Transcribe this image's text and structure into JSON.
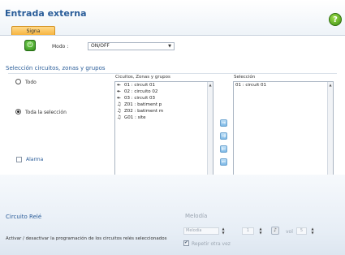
{
  "header": {
    "title": "Entrada externa",
    "help_glyph": "?",
    "tabs": [
      {
        "label": "Signa"
      }
    ]
  },
  "mode": {
    "label": "Modo :",
    "value": "ON/OFF",
    "power_icon": "power-icon"
  },
  "selection_section": {
    "title": "Selección circuitos, zonas y grupos",
    "radio_options": [
      {
        "label": "Todo",
        "selected": false
      },
      {
        "label": "Toda la selección",
        "selected": true
      }
    ],
    "alarm_label": "Alarma",
    "available_caption": "Cicuitos, Zonas y grupos",
    "available_items": [
      {
        "glyph": "↞",
        "text": "01 : circuit  01"
      },
      {
        "glyph": "↞",
        "text": "02 : circuito  02"
      },
      {
        "glyph": "↞",
        "text": "03 : circuit  03"
      },
      {
        "glyph": "♫",
        "text": "Z01 : batiment p"
      },
      {
        "glyph": "♫",
        "text": "Z02 : batiment m"
      },
      {
        "glyph": "♫",
        "text": "G01 : site"
      }
    ],
    "selected_caption": "Selección",
    "selected_items": [
      {
        "text": "01 : circuit  01"
      }
    ],
    "transfer_buttons": [
      "⇒",
      "⇉",
      "⇇",
      "⇐"
    ]
  },
  "relay_section": {
    "title": "Circuito Relé",
    "description": "Activar / desactivar la programación de los circuitos relés seleccionados"
  },
  "melody_section": {
    "title": "Melodía",
    "melody_placeholder": "Melodía",
    "count_value": "1",
    "vol_label": "vol",
    "vol_value": "5",
    "repeat_label": "Repetir otra vez",
    "repeat_checked": true
  }
}
